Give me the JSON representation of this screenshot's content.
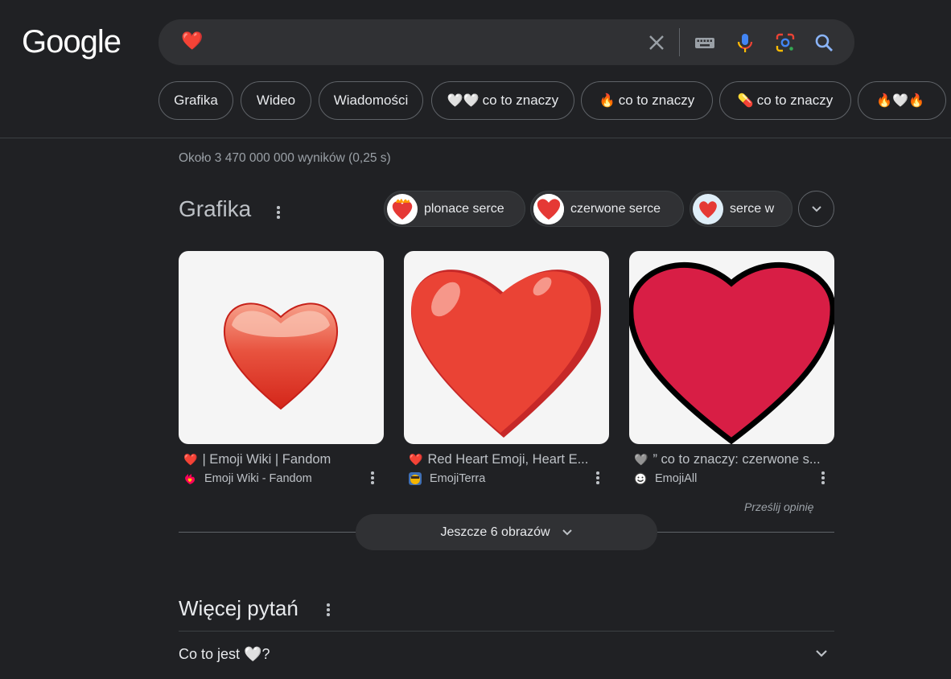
{
  "logo": "Google",
  "search": {
    "query": "❤️",
    "icons": [
      "close-icon",
      "keyboard-icon",
      "mic-icon",
      "lens-icon",
      "search-icon"
    ]
  },
  "chips": [
    {
      "emoji": "",
      "label": "Grafika"
    },
    {
      "emoji": "",
      "label": "Wideo"
    },
    {
      "emoji": "",
      "label": "Wiadomości"
    },
    {
      "emoji": "🤍🤍",
      "label": "co to znaczy"
    },
    {
      "emoji": "🔥",
      "label": "co to znaczy"
    },
    {
      "emoji": "💊",
      "label": "co to znaczy"
    },
    {
      "emoji": "🔥🤍🔥",
      "label": ""
    }
  ],
  "stats": "Około 3 470 000 000 wyników (0,25 s)",
  "images_section": {
    "title": "Grafika",
    "filters": [
      "plonace serce",
      "czerwone serce",
      "serce w"
    ],
    "cards": [
      {
        "title_icon": "❤️",
        "title": "| Emoji Wiki | Fandom",
        "source": "Emoji Wiki - Fandom"
      },
      {
        "title_icon": "❤️",
        "title": "Red Heart Emoji, Heart E...",
        "source": "EmojiTerra"
      },
      {
        "title_icon": "🩶",
        "title": "” co to znaczy: czerwone s...",
        "source": "EmojiAll"
      }
    ],
    "feedback": "Prześlij opinię",
    "more_button": "Jeszcze 6 obrazów"
  },
  "paa": {
    "title": "Więcej pytań",
    "questions": [
      "Co to jest 🤍?"
    ]
  },
  "colors": {
    "background": "#202124",
    "surface": "#303134",
    "heart_red": "#e53935"
  }
}
